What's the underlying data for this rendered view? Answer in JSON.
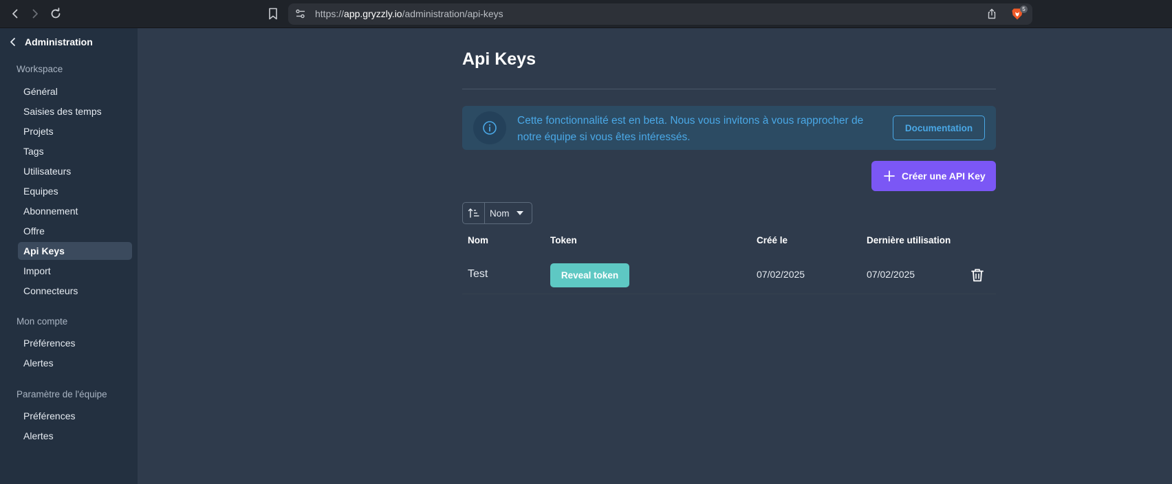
{
  "browser": {
    "url_prefix": "https://",
    "url_host": "app.gryzzly.io",
    "url_path": "/administration/api-keys",
    "brave_badge": "5"
  },
  "sidebar": {
    "back_label": "Administration",
    "sections": [
      {
        "title": "Workspace",
        "items": [
          {
            "label": "Général"
          },
          {
            "label": "Saisies des temps"
          },
          {
            "label": "Projets"
          },
          {
            "label": "Tags"
          },
          {
            "label": "Utilisateurs"
          },
          {
            "label": "Equipes"
          },
          {
            "label": "Abonnement"
          },
          {
            "label": "Offre"
          },
          {
            "label": "Api Keys",
            "active": true
          },
          {
            "label": "Import"
          },
          {
            "label": "Connecteurs"
          }
        ]
      },
      {
        "title": "Mon compte",
        "items": [
          {
            "label": "Préférences"
          },
          {
            "label": "Alertes"
          }
        ]
      },
      {
        "title": "Paramètre de l'équipe",
        "items": [
          {
            "label": "Préférences"
          },
          {
            "label": "Alertes"
          }
        ]
      }
    ]
  },
  "main": {
    "title": "Api Keys",
    "banner": {
      "message": "Cette fonctionnalité est en beta. Nous vous invitons à vous rapprocher de notre équipe si vous êtes intéressés.",
      "doc_button": "Documentation"
    },
    "create_button": "Créer une API Key",
    "sort": {
      "field": "Nom"
    },
    "table": {
      "headers": {
        "name": "Nom",
        "token": "Token",
        "created": "Créé le",
        "last_used": "Dernière utilisation"
      },
      "rows": [
        {
          "name": "Test",
          "token_button": "Reveal token",
          "created": "07/02/2025",
          "last_used": "07/02/2025"
        }
      ]
    }
  },
  "colors": {
    "accent": "#7b57f5",
    "info": "#4aa8e6",
    "reveal": "#5ec8c3",
    "background": "#2f3b4c",
    "sidebar": "#233040"
  }
}
